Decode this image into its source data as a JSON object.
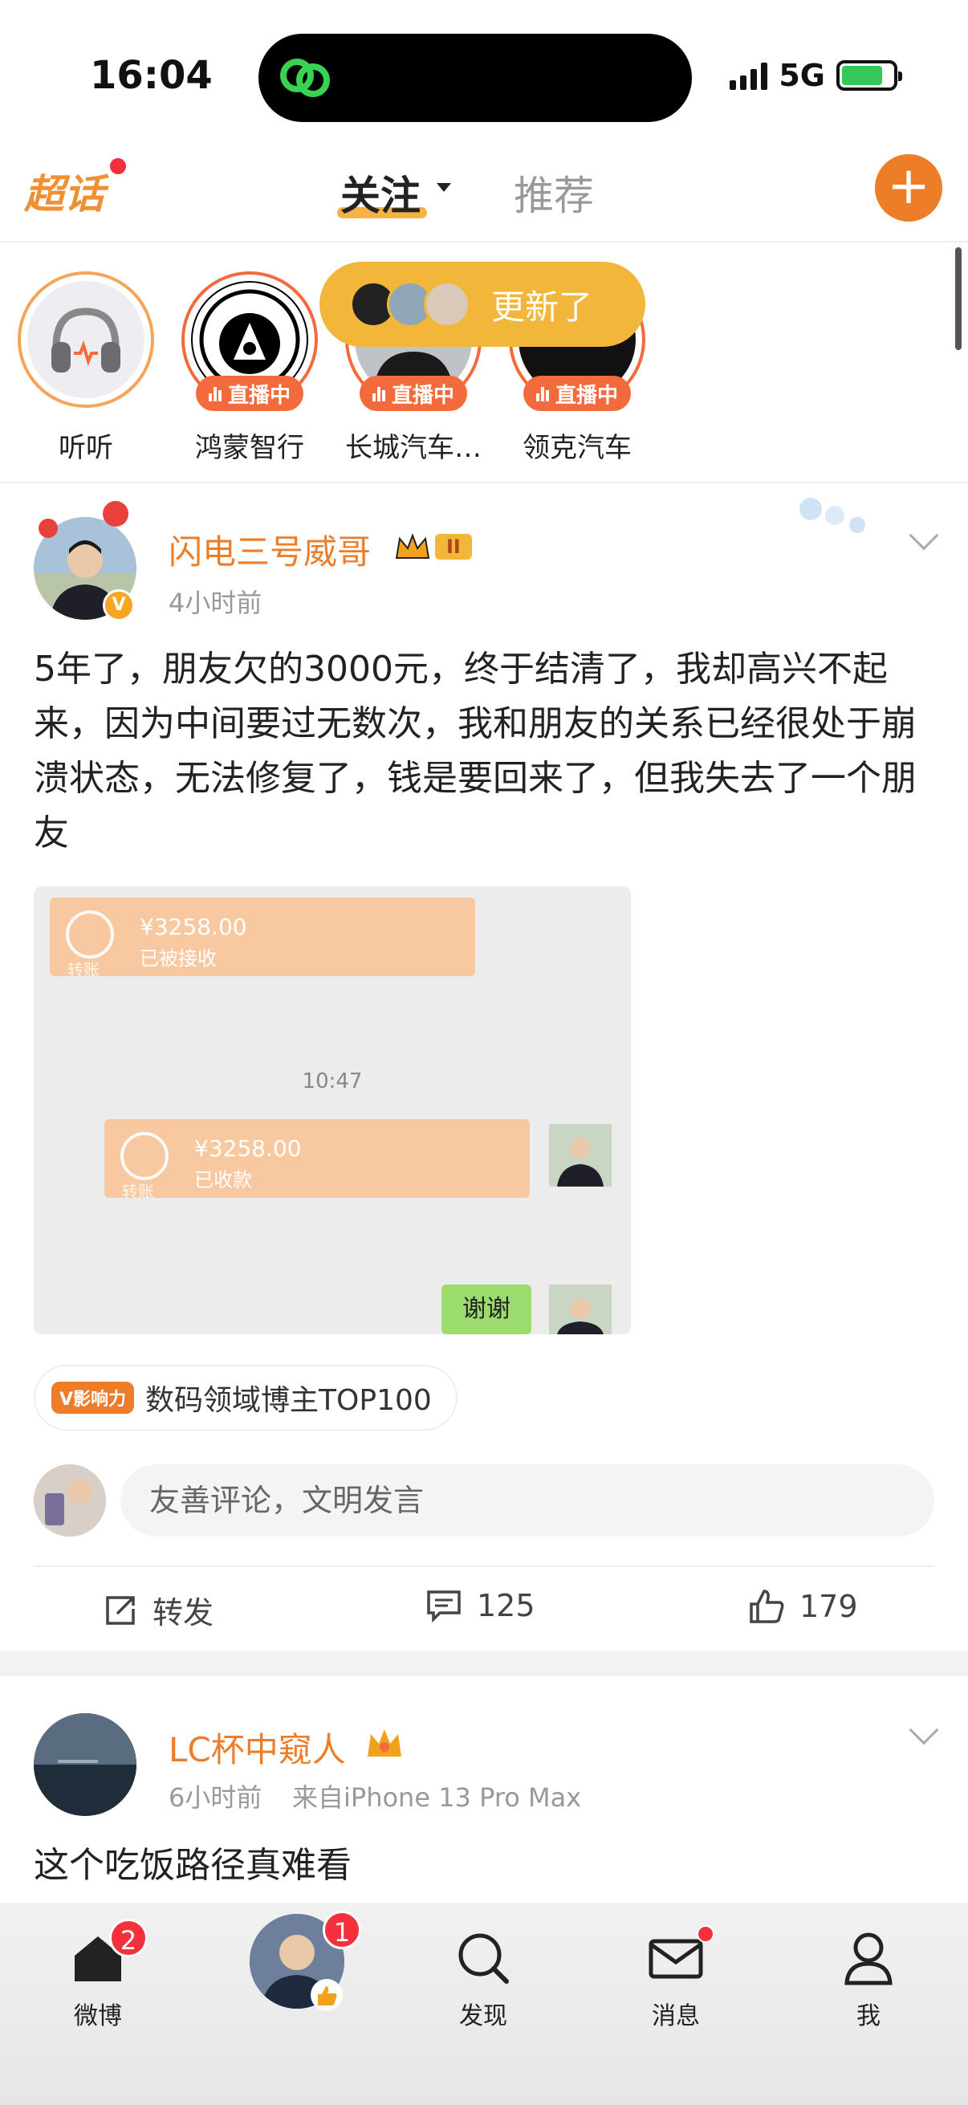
{
  "status_bar": {
    "time": "16:04",
    "network": "5G"
  },
  "topnav": {
    "chaohua": "超话",
    "tabs": [
      {
        "label": "关注",
        "active": true
      },
      {
        "label": "推荐",
        "active": false
      }
    ],
    "plus_icon": "plus-icon"
  },
  "stories": {
    "items": [
      {
        "label": "听听",
        "live": false
      },
      {
        "label": "鸿蒙智行",
        "live": true,
        "badge": "直播中"
      },
      {
        "label": "长城汽车…",
        "live": true,
        "badge": "直播中"
      },
      {
        "label": "领克汽车",
        "live": true,
        "badge": "直播中"
      }
    ],
    "update_pill": "更新了"
  },
  "post1": {
    "username": "闪电三号威哥",
    "level": "II",
    "time": "4小时前",
    "text": "5年了，朋友欠的3000元，终于结清了，我却高兴不起来，因为中间要过无数次，我和朋友的关系已经很处于崩溃状态，无法修复了，钱是要回来了，但我失去了一个朋友",
    "image": {
      "transfer1_amount": "¥3258.00",
      "transfer1_status": "已被接收",
      "transfer1_foot": "转账",
      "time": "10:47",
      "transfer2_amount": "¥3258.00",
      "transfer2_status": "已收款",
      "transfer2_foot": "转账",
      "thanks": "谢谢"
    },
    "influence_badge": "V影响力",
    "influence_text": "数码领域博主TOP100",
    "comment_placeholder": "友善评论，文明发言",
    "actions": {
      "repost": "转发",
      "comments": "125",
      "likes": "179"
    }
  },
  "post2": {
    "username": "LC杯中窥人",
    "time": "6小时前",
    "source": "来自iPhone 13 Pro Max",
    "text": "这个吃饭路径真难看"
  },
  "bottom_nav": [
    {
      "label": "微博",
      "badge": "2"
    },
    {
      "label": "",
      "badge": "1"
    },
    {
      "label": "发现"
    },
    {
      "label": "消息",
      "dot": true
    },
    {
      "label": "我"
    }
  ],
  "colors": {
    "accent": "#ee7d2a",
    "live": "#f36b3c",
    "pill": "#f2b73a",
    "badge": "#f5303d"
  }
}
